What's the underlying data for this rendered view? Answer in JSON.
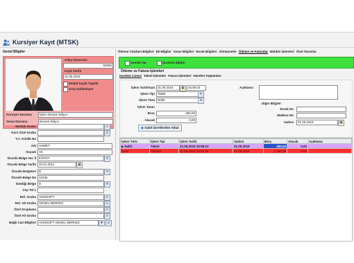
{
  "window": {
    "title": "Kursiyer Kayıt (MTSK)"
  },
  "left": {
    "section_title": "Genel Bilgiler",
    "aday_numarasi_label": "Aday Numarası",
    "aday_numarasi_value": "50005",
    "kayit_tarihi_label": "Kayıt Tarihi",
    "kayit_tarihi_value": "31.05.2019",
    "modul_kaydi_label": "Modül Kaydı Yapıldı",
    "arac_kullaniliyor_label": "Araç Kullanılıyor",
    "kursiyer_durumu_label": "Kursiyer Durumu",
    "kursiyer_durumu_value": "İşlem Devam Ediyor",
    "sinav_durumu_label": "Sınav Durumu",
    "sinav_durumu_value": "Devam Ediyor",
    "fields": [
      {
        "label": "Meslek Grubu",
        "value": ""
      },
      {
        "label": "Kurs Özel Grubu",
        "value": ""
      },
      {
        "label": "T.C. Kimlik No",
        "value": ""
      },
      {
        "label": "Adı",
        "value": "AHMET"
      },
      {
        "label": "Soyadı",
        "value": "AK"
      },
      {
        "label": "Önceki Belge Ver. İl",
        "value": "KONYA"
      },
      {
        "label": "Önceki Belge Tarihi",
        "value": "10.01.2012"
      },
      {
        "label": "Önceki Belgeleri",
        "value": "B"
      },
      {
        "label": "Önceki Belge No",
        "value": "12345"
      },
      {
        "label": "İstediği Belge",
        "value": "D"
      },
      {
        "label": "Cep Tel 1",
        "value": ""
      },
      {
        "label": "Ref. Grubu",
        "value": "AKINSOFT"
      },
      {
        "label": "Ref. Alt Grubu",
        "value": "GENEL MERKEZ"
      },
      {
        "label": "Özel Gruplama",
        "value": ""
      },
      {
        "label": "Özel Alt Grubu",
        "value": ""
      },
      {
        "label": "Bağlı Cari Bilgileri",
        "value": "AKINSOFT GENEL MERKEZ"
      }
    ]
  },
  "menu": {
    "items": [
      "Ödeme Cüzdanı Bilgileri",
      "Ek Bilgiler",
      "Sınav Bilgileri",
      "Evrak Bilgileri",
      "Görüşmeler",
      "Ödeme ve Faturalar",
      "Mebbis İşlemleri",
      "Özel Tanımlar"
    ],
    "active_index": 5
  },
  "green_bar": {
    "senedi_var": "Senedi Var",
    "ucretsiz_egitim": "Ücretsiz Eğitim"
  },
  "payment": {
    "section_title": "Ödeme ve Fatura İşlemleri",
    "subtabs": [
      "Hareket Listesi",
      "Taksit İşlemleri",
      "Fatura İşlemleri",
      "Hareket Toplamları"
    ],
    "islem_tarih_saat_label": "İşlem Tarih/Saat",
    "islem_tarih_value": "31.05.2019",
    "islem_saat_value": "16:58:22",
    "islem_tipi_label": "İşlem Tipi",
    "islem_tipi_value": "Taksit",
    "islem_turu_label": "İşlem Türü",
    "islem_turu_value": "Nakit",
    "islem_tutari_label": "İşlem Tutarı",
    "borc_label": "Borç",
    "borc_value": "250,00",
    "alacak_label": "Alacak",
    "alacak_value": "0,00",
    "sabit_button": "Sabit Ücretlerden Aktar",
    "aciklama_label": "Açıklama",
    "diger_bilgiler_label": "Diğer Bilgiler",
    "evrak_no_label": "Evrak No",
    "makbuz_no_label": "Makbuz No",
    "vadesi_label": "Vadesi",
    "vadesi_value": "31.05.2019"
  },
  "grid": {
    "columns": [
      "İşlem Türü",
      "İşlem Tipi",
      "İşlem Tarihi",
      "Vadesi",
      "Borç",
      "Alacak",
      "Açıklama"
    ],
    "rows": [
      [
        "Nakit",
        "Taksit",
        "31.05.2019 16:58:22",
        "31.05.2019",
        "250,00",
        "0,00",
        ""
      ],
      [
        "Nakit",
        "Tahsilat",
        "31.05.2019 16:58:45",
        "31.05.2019",
        "1.000,00",
        "0,00",
        ""
      ]
    ]
  },
  "colors": {
    "accent_red": "#f08c8c",
    "green_bar": "#3ee03e",
    "row_selected": "#d7a4ff",
    "row_error": "#ff3030"
  }
}
